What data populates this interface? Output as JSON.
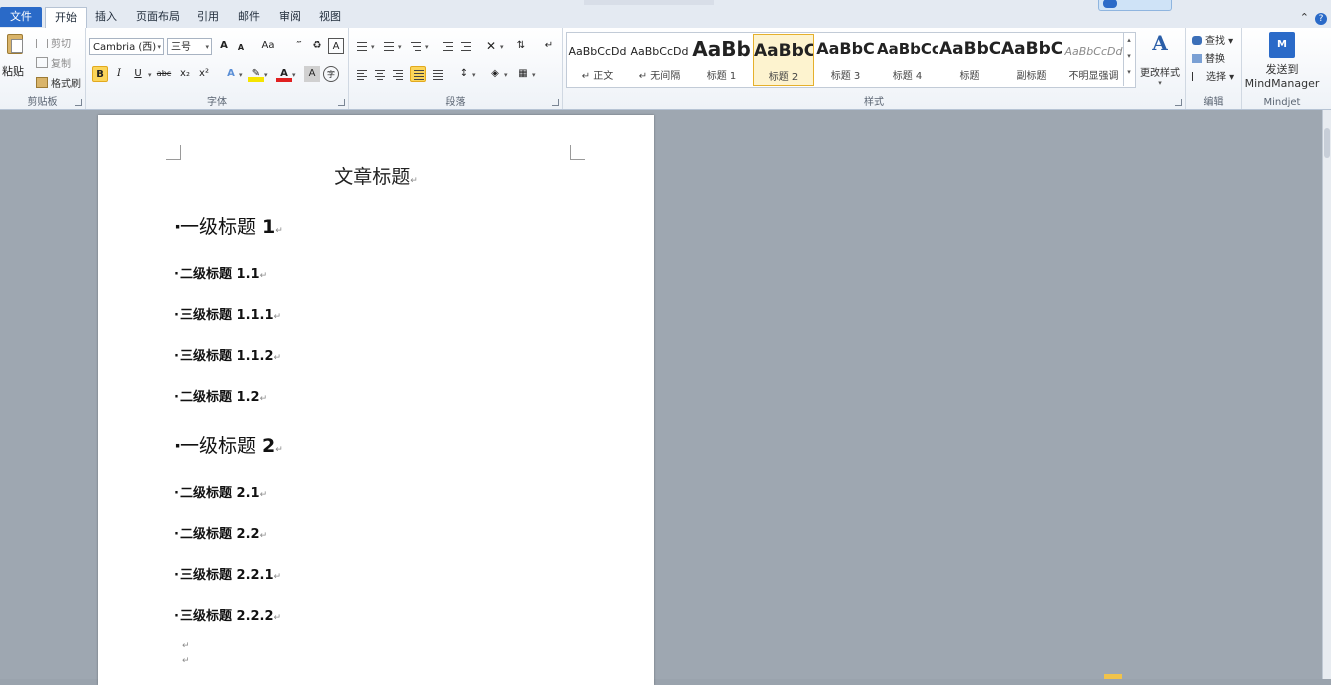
{
  "tabs": [
    {
      "label": "文件"
    },
    {
      "label": "开始"
    },
    {
      "label": "插入"
    },
    {
      "label": "页面布局"
    },
    {
      "label": "引用"
    },
    {
      "label": "邮件"
    },
    {
      "label": "审阅"
    },
    {
      "label": "视图"
    }
  ],
  "clipboard": {
    "paste_label": "粘贴",
    "cut_label": "剪切",
    "copy_label": "复制",
    "format_painter_label": "格式刷",
    "group_label": "剪贴板"
  },
  "font": {
    "font_name": "Cambria (西)",
    "font_size": "三号",
    "group_label": "字体",
    "grow_label": "A",
    "shrink_label": "A",
    "case_label": "Aa",
    "bold_label": "B",
    "italic_label": "I",
    "underline_label": "U",
    "strike_label": "abc",
    "sub_label": "x₂",
    "sup_label": "x²",
    "font_color_label": "A",
    "char_shade_label": "A",
    "enclose_label": "字"
  },
  "paragraph": {
    "group_label": "段落"
  },
  "styles": {
    "group_label": "样式",
    "items": [
      {
        "sample": "AaBbCcDd",
        "name": "↵ 正文"
      },
      {
        "sample": "AaBbCcDd",
        "name": "↵ 无间隔"
      },
      {
        "sample": "AaBb",
        "name": "标题 1"
      },
      {
        "sample": "AaBbC",
        "name": "标题 2"
      },
      {
        "sample": "AaBbC",
        "name": "标题 3"
      },
      {
        "sample": "AaBbCc",
        "name": "标题 4"
      },
      {
        "sample": "AaBbC",
        "name": "标题"
      },
      {
        "sample": "AaBbC",
        "name": "副标题"
      },
      {
        "sample": "AaBbCcDd",
        "name": "不明显强调"
      }
    ],
    "change_styles_label": "更改样式"
  },
  "editing": {
    "group_label": "编辑",
    "find_label": "查找",
    "replace_label": "替换",
    "select_label": "选择"
  },
  "mindjet": {
    "group_label": "Mindjet",
    "send_label_1": "发送到",
    "send_label_2": "MindManager",
    "icon_text": "M"
  },
  "document": {
    "title": "文章标题",
    "headings": [
      {
        "level": 1,
        "text": "一级标题 ",
        "num": "1"
      },
      {
        "level": 2,
        "text": "二级标题 1.1"
      },
      {
        "level": 3,
        "text": "三级标题 1.1.1"
      },
      {
        "level": 3,
        "text": "三级标题 1.1.2"
      },
      {
        "level": 2,
        "text": "二级标题 1.2"
      },
      {
        "level": 1,
        "text": "一级标题 ",
        "num": "2"
      },
      {
        "level": 2,
        "text": "二级标题 2.1"
      },
      {
        "level": 2,
        "text": "二级标题 2.2"
      },
      {
        "level": 3,
        "text": "三级标题 2.2.1"
      },
      {
        "level": 3,
        "text": "三级标题 2.2.2"
      }
    ],
    "para_mark": "↵",
    "bullet": "·"
  },
  "colors": {
    "file_tab": "#2a6ac8",
    "highlight": "#fbd55a",
    "selected_style_border": "#e5b02c"
  }
}
